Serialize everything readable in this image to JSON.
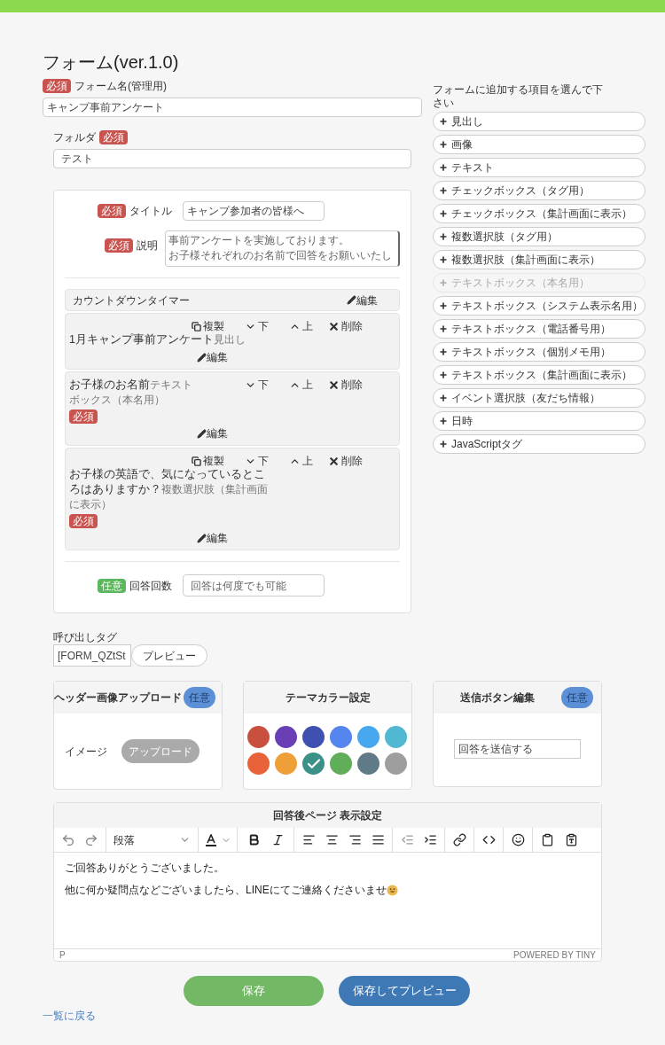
{
  "page_title": "フォーム(ver.1.0)",
  "form_name": {
    "badge": "必須",
    "label": "フォーム名(管理用)",
    "value": "キャンプ事前アンケート"
  },
  "folder": {
    "label": "フォルダ",
    "badge": "必須",
    "value": "テスト"
  },
  "title_field": {
    "badge": "必須",
    "label": "タイトル",
    "value": "キャンプ参加者の皆様へ"
  },
  "description_field": {
    "badge": "必須",
    "label": "説明",
    "lines": [
      "事前アンケートを実施しております。",
      "お子様それぞれのお名前で回答をお願いいたし"
    ]
  },
  "items": [
    {
      "kind": "timer",
      "title": "カウントダウンタイマー",
      "edit": "編集"
    },
    {
      "kind": "block",
      "actions": [
        {
          "kind": "copy",
          "label": "複製"
        },
        {
          "kind": "down",
          "label": "下"
        },
        {
          "kind": "up",
          "label": "上"
        },
        {
          "kind": "delete",
          "label": "削除"
        }
      ],
      "title": "1月キャンプ事前アンケート",
      "type": "見出し",
      "required": false,
      "edit": "編集"
    },
    {
      "kind": "block",
      "actions": [
        {
          "kind": "down",
          "label": "下"
        },
        {
          "kind": "up",
          "label": "上"
        },
        {
          "kind": "delete",
          "label": "削除"
        }
      ],
      "title": "お子様のお名前",
      "type": "テキストボックス（本名用）",
      "required": true,
      "badge": "必須",
      "edit": "編集"
    },
    {
      "kind": "block",
      "actions": [
        {
          "kind": "copy",
          "label": "複製"
        },
        {
          "kind": "down",
          "label": "下"
        },
        {
          "kind": "up",
          "label": "上"
        },
        {
          "kind": "delete",
          "label": "削除"
        }
      ],
      "title": "お子様の英語で、気になっているところはありますか？",
      "type": "複数選択肢（集計画面に表示）",
      "required": true,
      "badge": "必須",
      "edit": "編集"
    }
  ],
  "answer_count": {
    "badge": "任意",
    "label": "回答回数",
    "placeholder": "回答は何度でも可能"
  },
  "add_panel": {
    "heading": "フォームに追加する項目を選んで下さい",
    "items": [
      {
        "label": "見出し",
        "disabled": false
      },
      {
        "label": "画像",
        "disabled": false
      },
      {
        "label": "テキスト",
        "disabled": false
      },
      {
        "label": "チェックボックス（タグ用）",
        "disabled": false
      },
      {
        "label": "チェックボックス（集計画面に表示）",
        "disabled": false
      },
      {
        "label": "複数選択肢（タグ用）",
        "disabled": false
      },
      {
        "label": "複数選択肢（集計画面に表示）",
        "disabled": false
      },
      {
        "label": "テキストボックス（本名用）",
        "disabled": true
      },
      {
        "label": "テキストボックス（システム表示名用）",
        "disabled": false
      },
      {
        "label": "テキストボックス（電話番号用）",
        "disabled": false
      },
      {
        "label": "テキストボックス（個別メモ用）",
        "disabled": false
      },
      {
        "label": "テキストボックス（集計画面に表示）",
        "disabled": false
      },
      {
        "label": "イベント選択肢（友だち情報）",
        "disabled": false
      },
      {
        "label": "日時",
        "disabled": false
      },
      {
        "label": "JavaScriptタグ",
        "disabled": false
      }
    ]
  },
  "call_tag": {
    "label": "呼び出しタグ",
    "value": "[FORM_QZtSt",
    "preview": "プレビュー"
  },
  "header_image": {
    "title": "ヘッダー画像アップロード",
    "badge": "任意",
    "label": "イメージ",
    "button": "アップロード"
  },
  "theme_color": {
    "title": "テーマカラー設定",
    "colors": [
      {
        "color": "#c9503f",
        "selected": false
      },
      {
        "color": "#6a3fb5",
        "selected": false
      },
      {
        "color": "#4050b0",
        "selected": false
      },
      {
        "color": "#5585ef",
        "selected": false
      },
      {
        "color": "#47a8ef",
        "selected": false
      },
      {
        "color": "#50b8d0",
        "selected": false
      },
      {
        "color": "#e9623a",
        "selected": false
      },
      {
        "color": "#ef9f38",
        "selected": false
      },
      {
        "color": "#3b9088",
        "selected": true
      },
      {
        "color": "#60ad5a",
        "selected": false
      },
      {
        "color": "#607a88",
        "selected": false
      },
      {
        "color": "#9e9e9e",
        "selected": false
      }
    ]
  },
  "submit_button": {
    "title": "送信ボタン編集",
    "badge": "任意",
    "value": "回答を送信する"
  },
  "after_page": {
    "title": "回答後ページ 表示設定",
    "block_format": "段落",
    "paragraphs": [
      "ご回答ありがとうございました。",
      "他に何か疑問点などございましたら、LINEにてご連絡くださいませ"
    ],
    "path": "P",
    "branding": "POWERED BY TINY"
  },
  "buttons": [
    {
      "kind": "save",
      "label": "保存"
    },
    {
      "kind": "save_preview",
      "label": "保存してプレビュー"
    }
  ],
  "back_link": "一覧に戻る"
}
